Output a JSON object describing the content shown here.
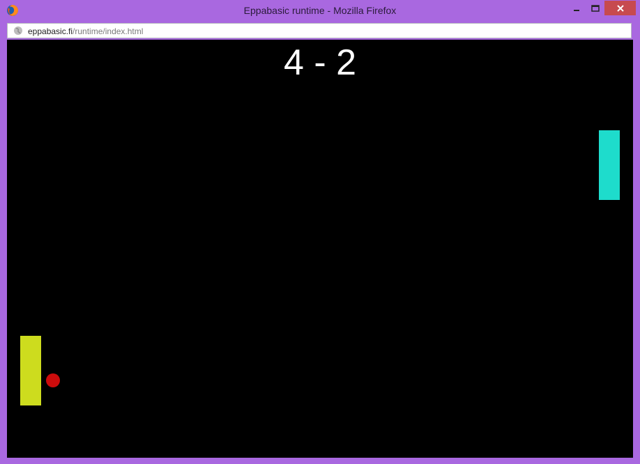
{
  "window": {
    "title": "Eppabasic runtime - Mozilla Firefox",
    "icon": "firefox-icon"
  },
  "address_bar": {
    "domain": "eppabasic.fi",
    "path": "/runtime/index.html",
    "icon": "globe-icon"
  },
  "game": {
    "score_text": "4 - 2",
    "score_left": 4,
    "score_right": 2,
    "colors": {
      "background": "#000000",
      "left_paddle": "#cddc1e",
      "right_paddle": "#1edccc",
      "ball": "#cc0c0c",
      "score": "#ffffff"
    }
  },
  "colors": {
    "window_frame": "#a968e0",
    "close_button": "#c74a4f"
  }
}
